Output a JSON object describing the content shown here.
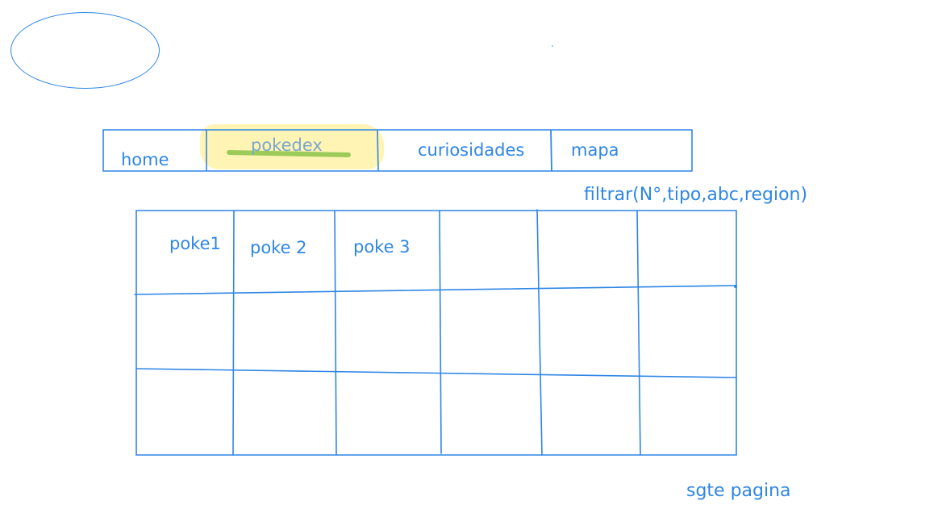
{
  "nav": {
    "items": [
      {
        "label": "home"
      },
      {
        "label": "pokedex",
        "active": true
      },
      {
        "label": "curiosidades"
      },
      {
        "label": "mapa"
      }
    ]
  },
  "filter": {
    "label": "filtrar(N°,tipo,abc,region)"
  },
  "grid": {
    "columns": 6,
    "rows": 3,
    "cells": [
      "poke1",
      "poke 2",
      "poke 3"
    ]
  },
  "pagination": {
    "next_label": "sgte pagina"
  },
  "colors": {
    "ink": "#2f86e6",
    "highlight": "#fff3b0",
    "active_underline": "#9ccb5a"
  }
}
